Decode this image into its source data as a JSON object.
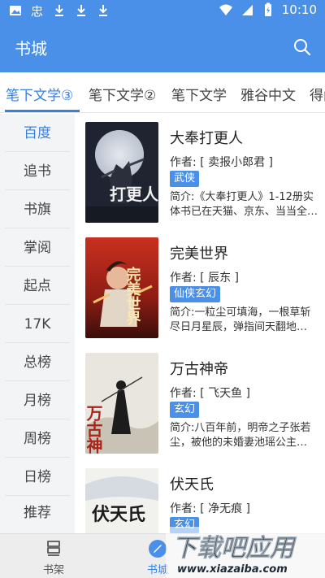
{
  "status_bar": {
    "time": "10:10",
    "left_icons": [
      "image-icon",
      "app-icon",
      "download-icon",
      "download-icon",
      "download-icon"
    ],
    "right_icons": [
      "wifi-icon",
      "no-sim-icon",
      "battery-icon"
    ]
  },
  "app_bar": {
    "title": "书城",
    "search_icon": "search-icon"
  },
  "tabs": [
    {
      "label": "笔下文学③",
      "active": true
    },
    {
      "label": "笔下文学②",
      "active": false
    },
    {
      "label": "笔下文学",
      "active": false
    },
    {
      "label": "雅谷中文",
      "active": false
    },
    {
      "label": "得阅",
      "active": false
    }
  ],
  "sidebar": [
    {
      "label": "百度",
      "active": true
    },
    {
      "label": "追书",
      "active": false
    },
    {
      "label": "书旗",
      "active": false
    },
    {
      "label": "掌阅",
      "active": false
    },
    {
      "label": "起点",
      "active": false
    },
    {
      "label": "17K",
      "active": false
    },
    {
      "label": "总榜",
      "active": false
    },
    {
      "label": "月榜",
      "active": false
    },
    {
      "label": "周榜",
      "active": false
    },
    {
      "label": "日榜",
      "active": false
    },
    {
      "label": "推荐",
      "active": false
    }
  ],
  "books": [
    {
      "name": "大奉打更人",
      "author": "作者: [ 卖报小郎君 ]",
      "tag": "武侠",
      "desc": "简介:《大奉打更人》1-12册实体书已在天猫、京东、当当全…",
      "cover_title": "打更人"
    },
    {
      "name": "完美世界",
      "author": "作者: [ 辰东 ]",
      "tag": "仙侠玄幻",
      "desc": "简介:一粒尘可填海，一根草斩尽日月星辰，弹指间天翻地…",
      "cover_title": "完美世界"
    },
    {
      "name": "万古神帝",
      "author": "作者: [ 飞天鱼 ]",
      "tag": "玄幻",
      "desc": "简介:八百年前，明帝之子张若尘，被他的未婚妻池瑶公主…",
      "cover_title": "万古神帝"
    },
    {
      "name": "伏天氏",
      "author": "作者: [ 净无痕 ]",
      "tag": "玄幻",
      "desc": "",
      "cover_title": "伏天氏"
    }
  ],
  "bottom_nav": [
    {
      "label": "书架",
      "icon": "bookshelf-icon",
      "active": false
    },
    {
      "label": "书城",
      "icon": "bookstore-icon",
      "active": true
    }
  ],
  "watermark": {
    "title": "下载吧应用",
    "url": "www.xiazaiba.com"
  },
  "colors": {
    "primary": "#4a90e8",
    "active_text": "#3a7fd8",
    "sidebar_bg": "#f3f4f6",
    "nav_bg": "#ededed"
  }
}
